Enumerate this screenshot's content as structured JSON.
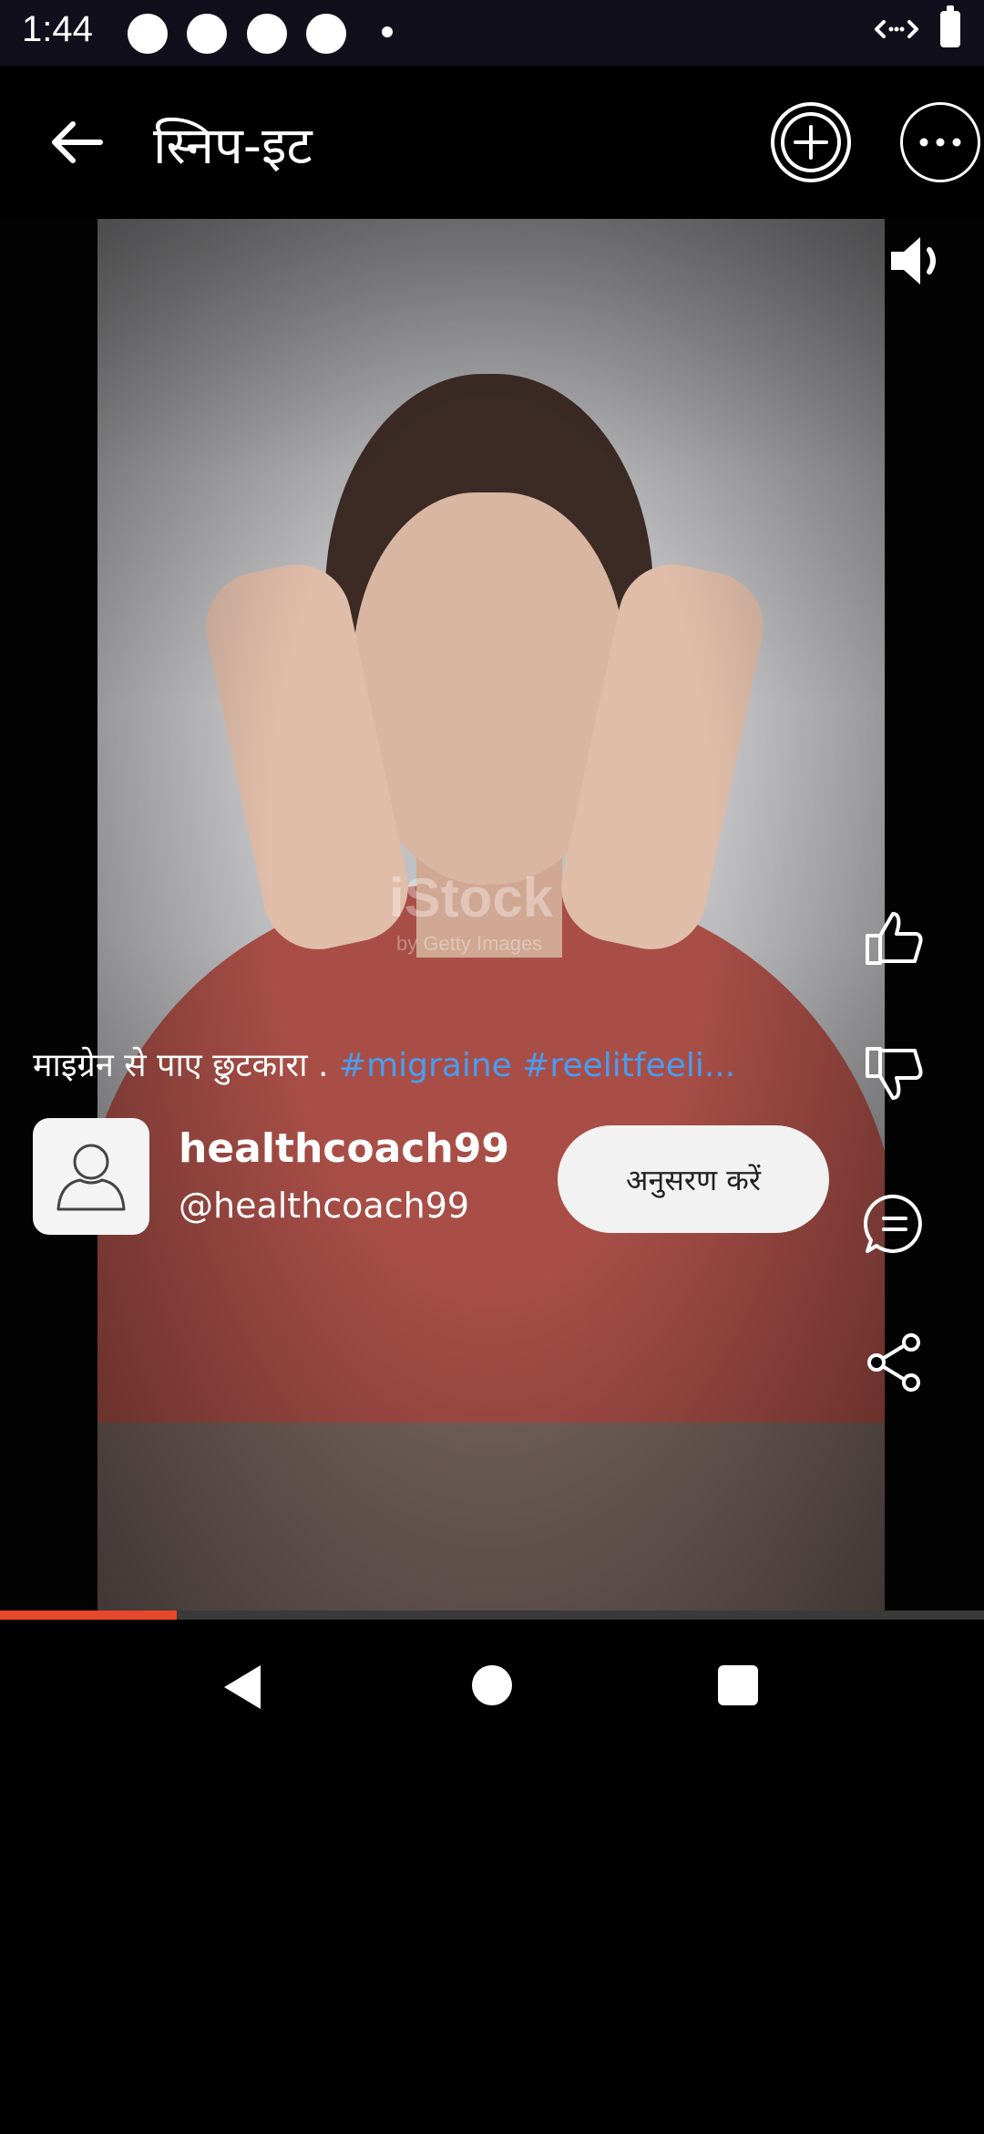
{
  "status_bar": {
    "time": "1:44"
  },
  "app_bar": {
    "title": "स्निप-इट",
    "icons": [
      "back-arrow-icon",
      "add-icon",
      "more-icon"
    ]
  },
  "video": {
    "watermark": "iStock",
    "watermark_sub": "by Getty Images",
    "progress_fraction": 0.18
  },
  "actions": [
    "volume-icon",
    "like-icon",
    "dislike-icon",
    "comment-icon",
    "share-icon"
  ],
  "caption": {
    "text": "माइग्रेन से पाए छुटकारा .",
    "hashtags": "#migraine #reelitfeeli..."
  },
  "author": {
    "name": "healthcoach99",
    "handle": "@healthcoach99",
    "follow_label": "अनुसरण करें"
  },
  "colors": {
    "hashtag": "#4a9df0",
    "progress": "#e8472c"
  }
}
